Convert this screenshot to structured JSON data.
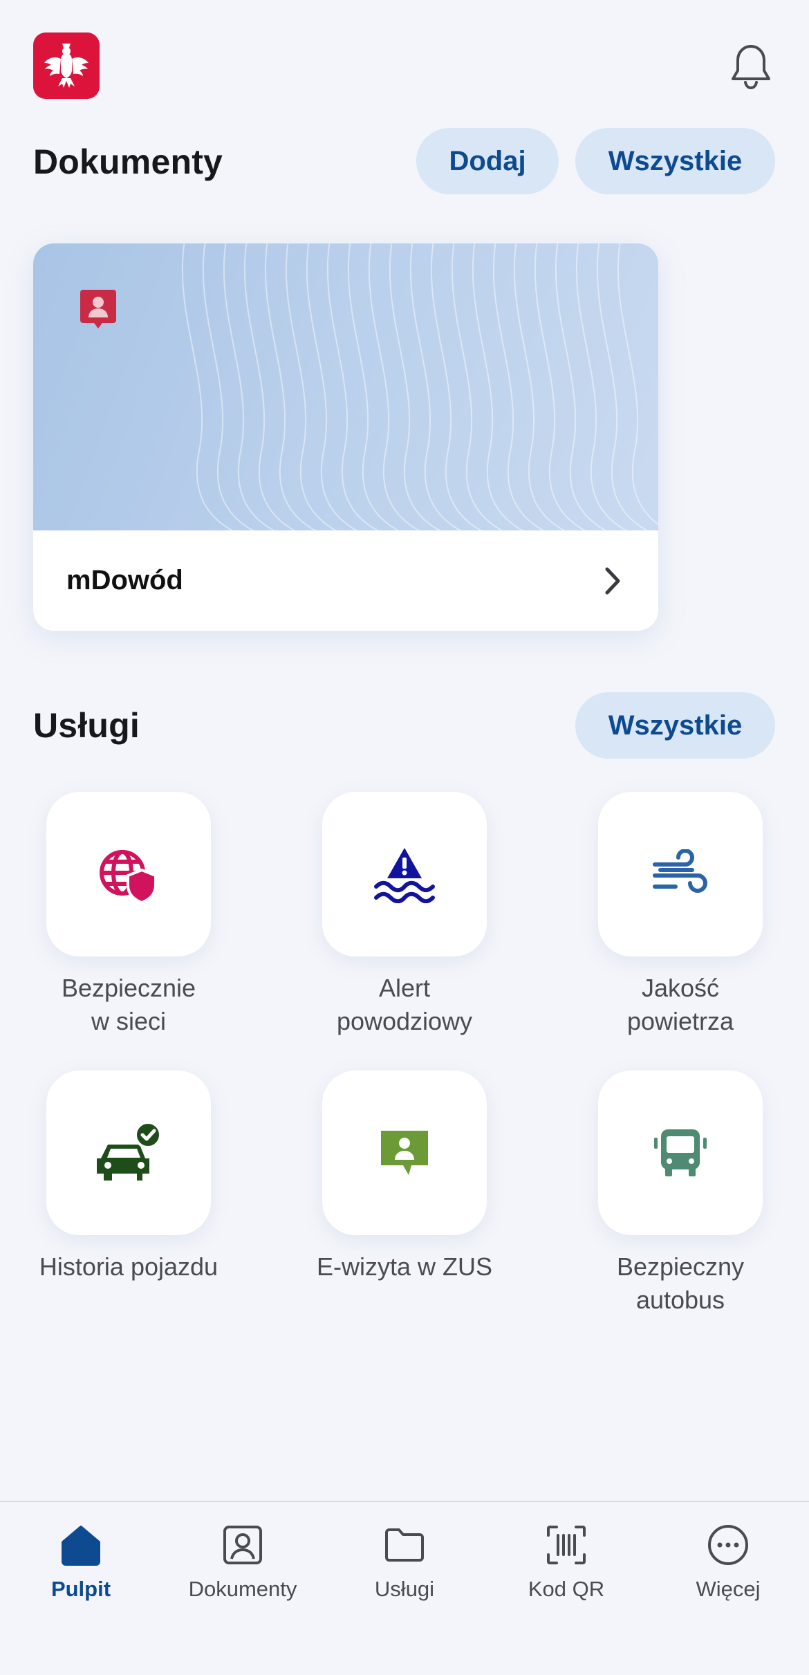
{
  "header": {
    "logo_icon": "polish-eagle-emblem-icon",
    "notification_icon": "bell-icon"
  },
  "documents": {
    "title": "Dokumenty",
    "add_label": "Dodaj",
    "all_label": "Wszystkie",
    "card": {
      "title": "mDowód",
      "icon": "id-card-person-icon",
      "arrow_icon": "chevron-right-icon"
    }
  },
  "services": {
    "title": "Usługi",
    "all_label": "Wszystkie",
    "items": [
      {
        "label_line1": "Bezpiecznie",
        "label_line2": "w sieci",
        "icon": "globe-shield-icon",
        "color": "#d1135d"
      },
      {
        "label_line1": "Alert",
        "label_line2": "powodziowy",
        "icon": "flood-warning-icon",
        "color": "#11139e"
      },
      {
        "label_line1": "Jakość",
        "label_line2": "powietrza",
        "icon": "wind-icon",
        "color": "#2b63a8"
      },
      {
        "label_line1": "Historia pojazdu",
        "label_line2": "",
        "icon": "car-check-icon",
        "color": "#1f4d1a"
      },
      {
        "label_line1": "E-wizyta w ZUS",
        "label_line2": "",
        "icon": "video-chat-person-icon",
        "color": "#6b9a36"
      },
      {
        "label_line1": "Bezpieczny",
        "label_line2": "autobus",
        "icon": "bus-icon",
        "color": "#4f8a73"
      }
    ]
  },
  "tabbar": {
    "active_color": "#0d4a8f",
    "tabs": [
      {
        "label": "Pulpit",
        "icon": "home-icon",
        "active": true
      },
      {
        "label": "Dokumenty",
        "icon": "id-badge-icon",
        "active": false
      },
      {
        "label": "Usługi",
        "icon": "folder-icon",
        "active": false
      },
      {
        "label": "Kod QR",
        "icon": "qr-scan-icon",
        "active": false
      },
      {
        "label": "Więcej",
        "icon": "more-dots-icon",
        "active": false
      }
    ]
  }
}
